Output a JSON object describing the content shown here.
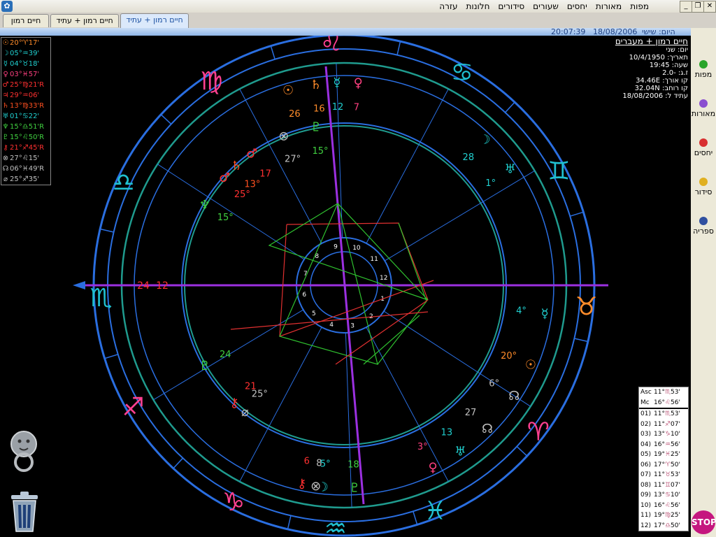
{
  "window": {
    "menus": [
      "מפות",
      "מאורות",
      "יחסים",
      "שעורים",
      "סידורים",
      "חלונות",
      "עזרה"
    ],
    "controls": {
      "minimize": "_",
      "restore": "❐",
      "close": "✕"
    }
  },
  "tabs": [
    "חיים רמון + עתיד",
    "חיים רמון + עתיד",
    "חיים רמון"
  ],
  "statusbar": {
    "time": "20:07:39",
    "date": "18/08/2006",
    "day": "היום: שישי"
  },
  "info": {
    "title": "חיים רמון + מעברים",
    "lines": [
      "יום: שני",
      "תאריך: 10/4/1950",
      "שעה: 19:45",
      "ז.ג: -2.0",
      "קו אורך: 34.46E",
      "קו רוחב: 32.04N",
      "עתיד ל: 18/08/2006"
    ]
  },
  "sidebar": [
    {
      "label": "מפות",
      "color": "#2aa52a"
    },
    {
      "label": "מאורות",
      "color": "#8a4fd0"
    },
    {
      "label": "יחסים",
      "color": "#d83030"
    },
    {
      "label": "סידור",
      "color": "#e0b020"
    },
    {
      "label": "ספריה",
      "color": "#3050a0"
    }
  ],
  "planets": [
    {
      "glyph": "☉",
      "deg": "20°",
      "sign": "♈",
      "min": "17'",
      "color": "#ff8c2a"
    },
    {
      "glyph": "☽",
      "deg": "05°",
      "sign": "♒",
      "min": "39'",
      "color": "#20d0d0"
    },
    {
      "glyph": "☿",
      "deg": "04°",
      "sign": "♉",
      "min": "18'",
      "color": "#20d0d0"
    },
    {
      "glyph": "♀",
      "deg": "03°",
      "sign": "♓",
      "min": "57'",
      "color": "#ff4080"
    },
    {
      "glyph": "♂",
      "deg": "25°",
      "sign": "♍",
      "min": "21'R",
      "color": "#ff3030"
    },
    {
      "glyph": "♃",
      "deg": "29°",
      "sign": "♒",
      "min": "06'",
      "color": "#ff3030"
    },
    {
      "glyph": "♄",
      "deg": "13°",
      "sign": "♍",
      "min": "33'R",
      "color": "#ff5020"
    },
    {
      "glyph": "♅",
      "deg": "01°",
      "sign": "♋",
      "min": "22'",
      "color": "#20d0d0"
    },
    {
      "glyph": "♆",
      "deg": "15°",
      "sign": "♎",
      "min": "51'R",
      "color": "#40d040"
    },
    {
      "glyph": "♇",
      "deg": "15°",
      "sign": "♌",
      "min": "50'R",
      "color": "#40d040"
    },
    {
      "glyph": "⚷",
      "deg": "21°",
      "sign": "♐",
      "min": "45'R",
      "color": "#ff3030"
    },
    {
      "glyph": "⊗",
      "deg": "27°",
      "sign": "♌",
      "min": "15'",
      "color": "#c0c0c0"
    },
    {
      "glyph": "☊",
      "deg": "06°",
      "sign": "♓",
      "min": "49'R",
      "color": "#c0c0c0"
    },
    {
      "glyph": "⌀",
      "deg": "25°",
      "sign": "♐",
      "min": "35'",
      "color": "#c0c0c0"
    }
  ],
  "houses": [
    {
      "label": "Asc",
      "deg": "11°",
      "sign": "♏",
      "min": "53'"
    },
    {
      "label": "Mc",
      "deg": "16°",
      "sign": "♌",
      "min": "56'"
    },
    {
      "label": "01)",
      "deg": "11°",
      "sign": "♏",
      "min": "53'"
    },
    {
      "label": "02)",
      "deg": "11°",
      "sign": "♐",
      "min": "07'"
    },
    {
      "label": "03)",
      "deg": "13°",
      "sign": "♑",
      "min": "10'"
    },
    {
      "label": "04)",
      "deg": "16°",
      "sign": "♒",
      "min": "56'"
    },
    {
      "label": "05)",
      "deg": "19°",
      "sign": "♓",
      "min": "25'"
    },
    {
      "label": "06)",
      "deg": "17°",
      "sign": "♈",
      "min": "50'"
    },
    {
      "label": "07)",
      "deg": "11°",
      "sign": "♉",
      "min": "53'"
    },
    {
      "label": "08)",
      "deg": "11°",
      "sign": "♊",
      "min": "07'"
    },
    {
      "label": "09)",
      "deg": "13°",
      "sign": "♋",
      "min": "10'"
    },
    {
      "label": "10)",
      "deg": "16°",
      "sign": "♌",
      "min": "56'"
    },
    {
      "label": "11)",
      "deg": "19°",
      "sign": "♍",
      "min": "25'"
    },
    {
      "label": "12)",
      "deg": "17°",
      "sign": "♎",
      "min": "50'"
    }
  ],
  "stop_label": "STOP",
  "wheel": {
    "zodiac": [
      {
        "glyph": "♌",
        "angle": 93,
        "color": "#ff4090"
      },
      {
        "glyph": "♋",
        "angle": 61,
        "color": "#20c0d0"
      },
      {
        "glyph": "♊",
        "angle": 28,
        "color": "#20c0d0"
      },
      {
        "glyph": "♉",
        "angle": -5,
        "color": "#ff8c2a"
      },
      {
        "glyph": "♈",
        "angle": -37,
        "color": "#ff4090"
      },
      {
        "glyph": "♓",
        "angle": -68,
        "color": "#20c0d0"
      },
      {
        "glyph": "♒",
        "angle": -92,
        "color": "#20c0d0"
      },
      {
        "glyph": "♑",
        "angle": -117,
        "color": "#ff4090"
      },
      {
        "glyph": "♐",
        "angle": -150,
        "color": "#ff4090"
      },
      {
        "glyph": "♏",
        "angle": -177,
        "color": "#20c0d0"
      },
      {
        "glyph": "♎",
        "angle": 155,
        "color": "#20c0d0"
      },
      {
        "glyph": "♍",
        "angle": 123,
        "color": "#ff4090"
      }
    ],
    "house_numbers": [
      "1",
      "2",
      "3",
      "4",
      "5",
      "6",
      "7",
      "8",
      "9",
      "10",
      "11",
      "12"
    ],
    "asc_labels": {
      "a": "24",
      "b": "12"
    },
    "outer_marks": [
      {
        "glyph": "♄",
        "text": "16",
        "color": "#ff8c2a",
        "angle": 98
      },
      {
        "glyph": "☿",
        "text": "12",
        "color": "#20d0d0",
        "angle": 92
      },
      {
        "glyph": "♀",
        "text": "7",
        "color": "#ff4080",
        "angle": 86
      },
      {
        "glyph": "☉",
        "text": "26",
        "color": "#ff8c2a",
        "angle": 106
      },
      {
        "glyph": "♂",
        "text": "17",
        "color": "#ff3030",
        "angle": 125
      },
      {
        "glyph": "☽",
        "text": "28",
        "color": "#20d0d0",
        "angle": 46
      },
      {
        "glyph": "♅",
        "text": "1°",
        "color": "#20d0d0",
        "angle": 35
      },
      {
        "glyph": "☿",
        "text": "4°",
        "color": "#20d0d0",
        "angle": -8
      },
      {
        "glyph": "☉",
        "text": "20°",
        "color": "#ff8c2a",
        "angle": -23
      },
      {
        "glyph": "☊",
        "text": "6°",
        "color": "#c0c0c0",
        "angle": -33
      },
      {
        "glyph": "♀",
        "text": "3°",
        "color": "#ff4080",
        "angle": -64
      },
      {
        "glyph": "☊",
        "text": "27",
        "color": "#c0c0c0",
        "angle": -45
      },
      {
        "glyph": "♅",
        "text": "13",
        "color": "#20d0d0",
        "angle": -55
      },
      {
        "glyph": "⊗",
        "text": "8",
        "color": "#c0c0c0",
        "angle": -98
      },
      {
        "glyph": "⚷",
        "text": "6",
        "color": "#ff3030",
        "angle": -102
      },
      {
        "glyph": "♇",
        "text": "18",
        "color": "#40d040",
        "angle": -87
      },
      {
        "glyph": "☽",
        "text": "5°",
        "color": "#20d0d0",
        "angle": -96
      },
      {
        "glyph": "♇",
        "text": "24",
        "color": "#40d040",
        "angle": -150
      },
      {
        "glyph": "⚷",
        "text": "21",
        "color": "#ff3030",
        "angle": -133
      },
      {
        "glyph": "⌀",
        "text": "25°",
        "color": "#c0c0c0",
        "angle": -128
      },
      {
        "glyph": "♆",
        "text": "15°",
        "color": "#40d040",
        "angle": 150
      },
      {
        "glyph": "♂",
        "text": "25°",
        "color": "#ff3030",
        "angle": 138
      },
      {
        "glyph": "♄",
        "text": "13°",
        "color": "#ff5020",
        "angle": 132
      },
      {
        "glyph": "⊗",
        "text": "27°",
        "color": "#c0c0c0",
        "angle": 112
      },
      {
        "glyph": "♇",
        "text": "15°",
        "color": "#40d040",
        "angle": 100
      }
    ]
  }
}
